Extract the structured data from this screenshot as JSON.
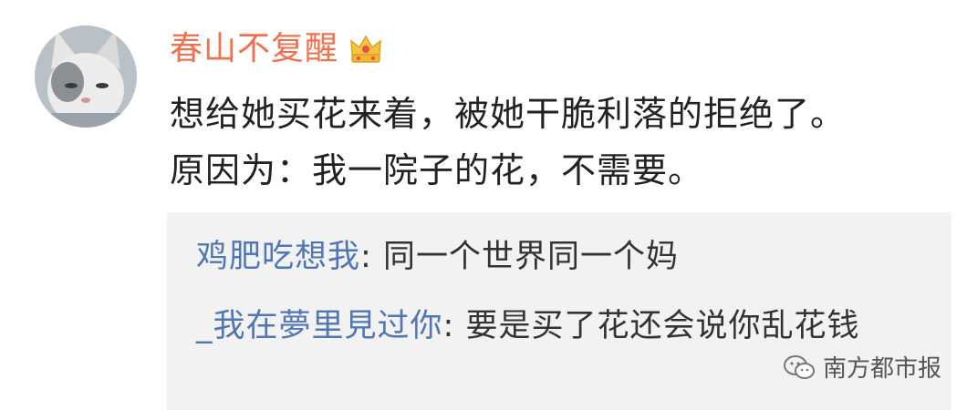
{
  "user": {
    "name": "春山不复醒",
    "badge_icon": "crown-icon"
  },
  "post": {
    "line1": "想给她买花来着，被她干脆利落的拒绝了。",
    "line2": "原因为：我一院子的花，不需要。"
  },
  "replies": [
    {
      "name": "鸡肥吃想我",
      "separator": ": ",
      "text": "同一个世界同一个妈"
    },
    {
      "name": "_我在夢里見过你",
      "separator": ": ",
      "text": "要是买了花还会说你乱花钱"
    }
  ],
  "watermark": {
    "icon": "wechat-icon",
    "text": "南方都市报"
  },
  "colors": {
    "username": "#eb7350",
    "reply_name": "#5177b3",
    "reply_bg": "#f2f2f2"
  }
}
